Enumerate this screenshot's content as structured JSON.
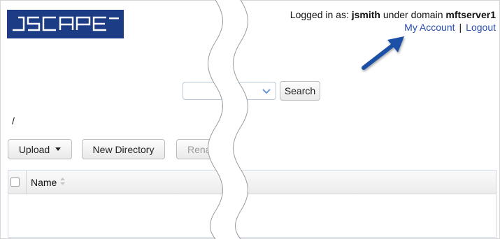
{
  "header": {
    "logo_text": "JSCAPE",
    "logged_in_prefix": "Logged in as:",
    "username": "jsmith",
    "domain_prefix": "under domain",
    "domain": "mftserver1",
    "my_account_label": "My Account",
    "separator": "|",
    "logout_label": "Logout"
  },
  "search": {
    "value": "",
    "button_label": "Search"
  },
  "path": "/",
  "toolbar": {
    "upload_label": "Upload",
    "new_directory_label": "New Directory",
    "rename_label": "Renam"
  },
  "table": {
    "columns": [
      "Name"
    ]
  },
  "colors": {
    "logo_bg": "#1d3c86",
    "link": "#2a4fb0",
    "arrow": "#1f4fa6"
  }
}
